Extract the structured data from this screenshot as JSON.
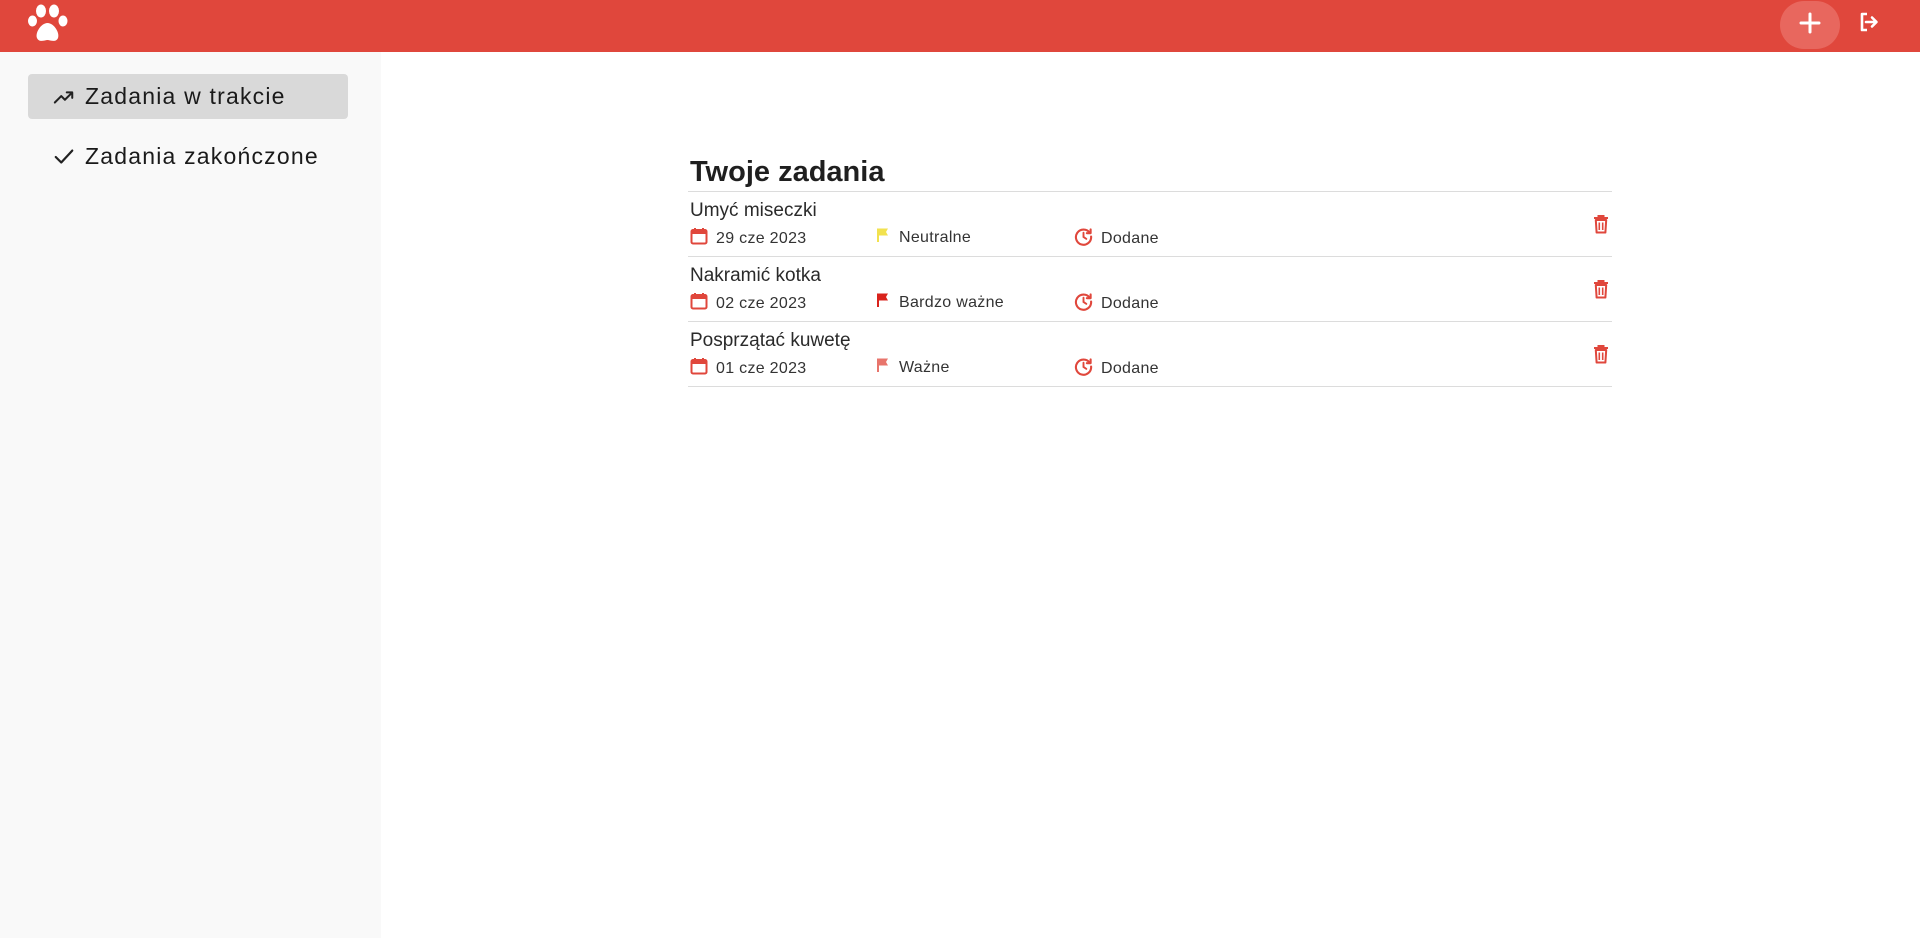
{
  "app": {
    "brand_color": "#e0473c",
    "logo_icon": "paw-icon",
    "add_icon": "plus-icon",
    "logout_icon": "logout-icon"
  },
  "sidebar": {
    "items": [
      {
        "label": "Zadania w trakcie",
        "icon": "trending-up-icon",
        "active": true
      },
      {
        "label": "Zadania zakończone",
        "icon": "checkmark-icon",
        "active": false
      }
    ]
  },
  "main": {
    "title": "Twoje zadania",
    "tasks": [
      {
        "title": "Umyć miseczki",
        "date": "29 cze 2023",
        "priority": "Neutralne",
        "priority_color": "#f2e24f",
        "status": "Dodane"
      },
      {
        "title": "Nakramić kotka",
        "date": "02 cze 2023",
        "priority": "Bardzo ważne",
        "priority_color": "#d9231c",
        "status": "Dodane"
      },
      {
        "title": "Posprzątać kuwetę",
        "date": "01 cze 2023",
        "priority": "Ważne",
        "priority_color": "#e8756c",
        "status": "Dodane"
      }
    ]
  }
}
